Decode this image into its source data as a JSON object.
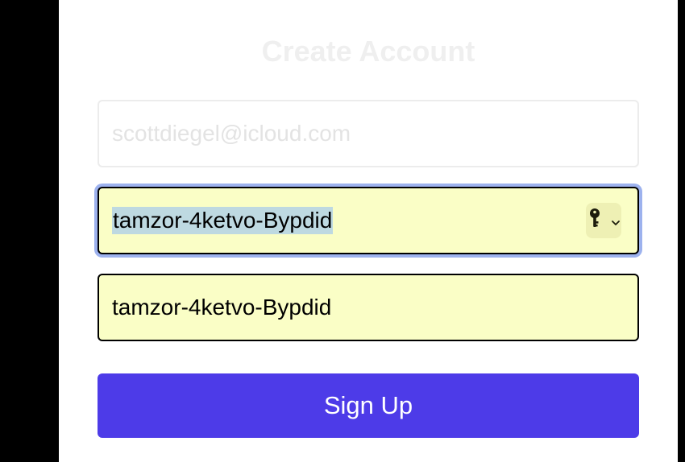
{
  "form": {
    "title": "Create Account",
    "email": {
      "placeholder": "scottdiegel@icloud.com",
      "value": ""
    },
    "password": {
      "value": "tamzor-4ketvo-Bypdid",
      "key_icon": "key-icon"
    },
    "confirm_password": {
      "value": "tamzor-4ketvo-Bypdid"
    },
    "submit_label": "Sign Up"
  },
  "colors": {
    "accent": "#4d3be8",
    "autofill_background": "#fafec6",
    "focus_ring": "#9db2ee",
    "selection": "#bed9e1"
  }
}
